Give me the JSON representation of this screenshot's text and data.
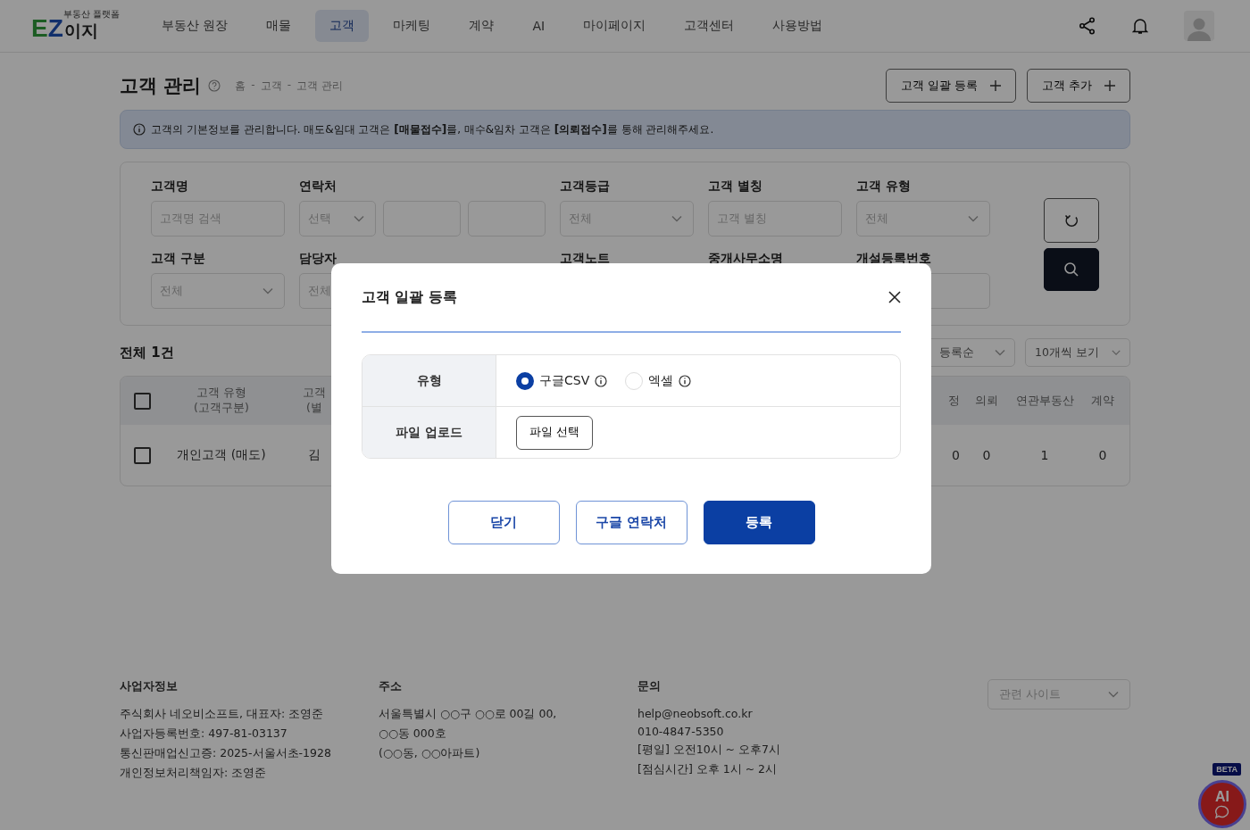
{
  "header": {
    "logo": {
      "mark": "EZ",
      "name": "이지",
      "tagline": "부동산 플랫폼"
    },
    "nav": [
      {
        "label": "부동산 원장",
        "selected": false
      },
      {
        "label": "매물",
        "selected": false
      },
      {
        "label": "고객",
        "selected": true
      },
      {
        "label": "마케팅",
        "selected": false
      },
      {
        "label": "계약",
        "selected": false
      },
      {
        "label": "AI",
        "selected": false
      },
      {
        "label": "마이페이지",
        "selected": false
      },
      {
        "label": "고객센터",
        "selected": false
      },
      {
        "label": "사용방법",
        "selected": false
      }
    ]
  },
  "page": {
    "title": "고객 관리",
    "breadcrumb": [
      "홈",
      "고객",
      "고객 관리"
    ],
    "breadcrumb_separator": "-",
    "actions": [
      {
        "label": "고객 일괄 등록"
      },
      {
        "label": "고객 추가"
      }
    ]
  },
  "notice": "고객의 기본정보를 관리합니다. 매도&임대 고객은 **[매물접수]**를, 매수&임차 고객은 **[의뢰접수]**를 통해 관리해주세요.",
  "filters": [
    {
      "label": "고객명",
      "fields": [
        {
          "kind": "input",
          "placeholder": "고객명 검색"
        }
      ]
    },
    {
      "label": "연락처",
      "fields": [
        {
          "kind": "select",
          "value": "선택"
        },
        {
          "kind": "input"
        },
        {
          "kind": "input"
        }
      ]
    },
    {
      "label": "고객등급",
      "fields": [
        {
          "kind": "select",
          "value": "전체"
        }
      ]
    },
    {
      "label": "고객 별칭",
      "fields": [
        {
          "kind": "input",
          "placeholder": "고객 별칭"
        }
      ]
    },
    {
      "label": "고객 유형",
      "fields": [
        {
          "kind": "select",
          "value": "전체"
        }
      ]
    },
    {
      "label": "고객 구분",
      "fields": [
        {
          "kind": "select",
          "value": "전체"
        }
      ]
    },
    {
      "label": "담당자",
      "fields": [
        {
          "kind": "select_partial",
          "value": "전체"
        }
      ]
    },
    {
      "label": "고객노트"
    },
    {
      "label": "중개사무소명"
    },
    {
      "label": "개설등록번호",
      "fields": [
        {
          "kind": "input"
        }
      ]
    }
  ],
  "results": {
    "count": "전체 1건",
    "sort": "등록순",
    "page_size": "10개씩 보기"
  },
  "table": {
    "all_checked": false,
    "columns": [
      {
        "label": "고객 유형",
        "sub": "(고객구분)"
      },
      {
        "label": "고객",
        "sub": "(별"
      },
      {
        "label": "정"
      },
      {
        "label": "의뢰"
      },
      {
        "label": "연관부동산"
      },
      {
        "label": "계약"
      }
    ],
    "rows": [
      {
        "checked": false,
        "cells": [
          "개인고객 (매도)",
          "김",
          "0",
          "0",
          "1",
          "0"
        ]
      }
    ]
  },
  "footer": {
    "columns": [
      {
        "title": "사업자정보",
        "lines": [
          "주식회사 네오비소프트, 대표자: 조영준",
          "사업자등록번호: 497-81-03137",
          "통신판매업신고증: 2025-서울서초-1928",
          "개인정보처리책임자: 조영준"
        ]
      },
      {
        "title": "주소",
        "lines": [
          "서울특별시 ○○구 ○○로 00길 00,",
          "○○동 000호",
          "(○○동, ○○아파트)"
        ]
      },
      {
        "title": "문의",
        "lines": [
          "help@neobsoft.co.kr",
          "010-4847-5350",
          "[평일] 오전10시 ~ 오후7시",
          "[점심시간] 오후 1시 ~ 2시"
        ]
      }
    ],
    "related_sites": "관련 사이트"
  },
  "fab": {
    "badge": "BETA",
    "label": "AI"
  },
  "modal": {
    "title": "고객 일괄 등록",
    "rows": [
      {
        "kind": "radio",
        "label": "유형",
        "options": [
          {
            "label": "구글CSV",
            "selected": true
          },
          {
            "label": "엑셀",
            "selected": false
          }
        ]
      },
      {
        "kind": "file",
        "label": "파일 업로드",
        "button": "파일 선택"
      }
    ],
    "buttons": [
      {
        "label": "닫기",
        "kind": "outline"
      },
      {
        "label": "구글 연락처",
        "kind": "outline"
      },
      {
        "label": "등록",
        "kind": "primary"
      }
    ]
  }
}
